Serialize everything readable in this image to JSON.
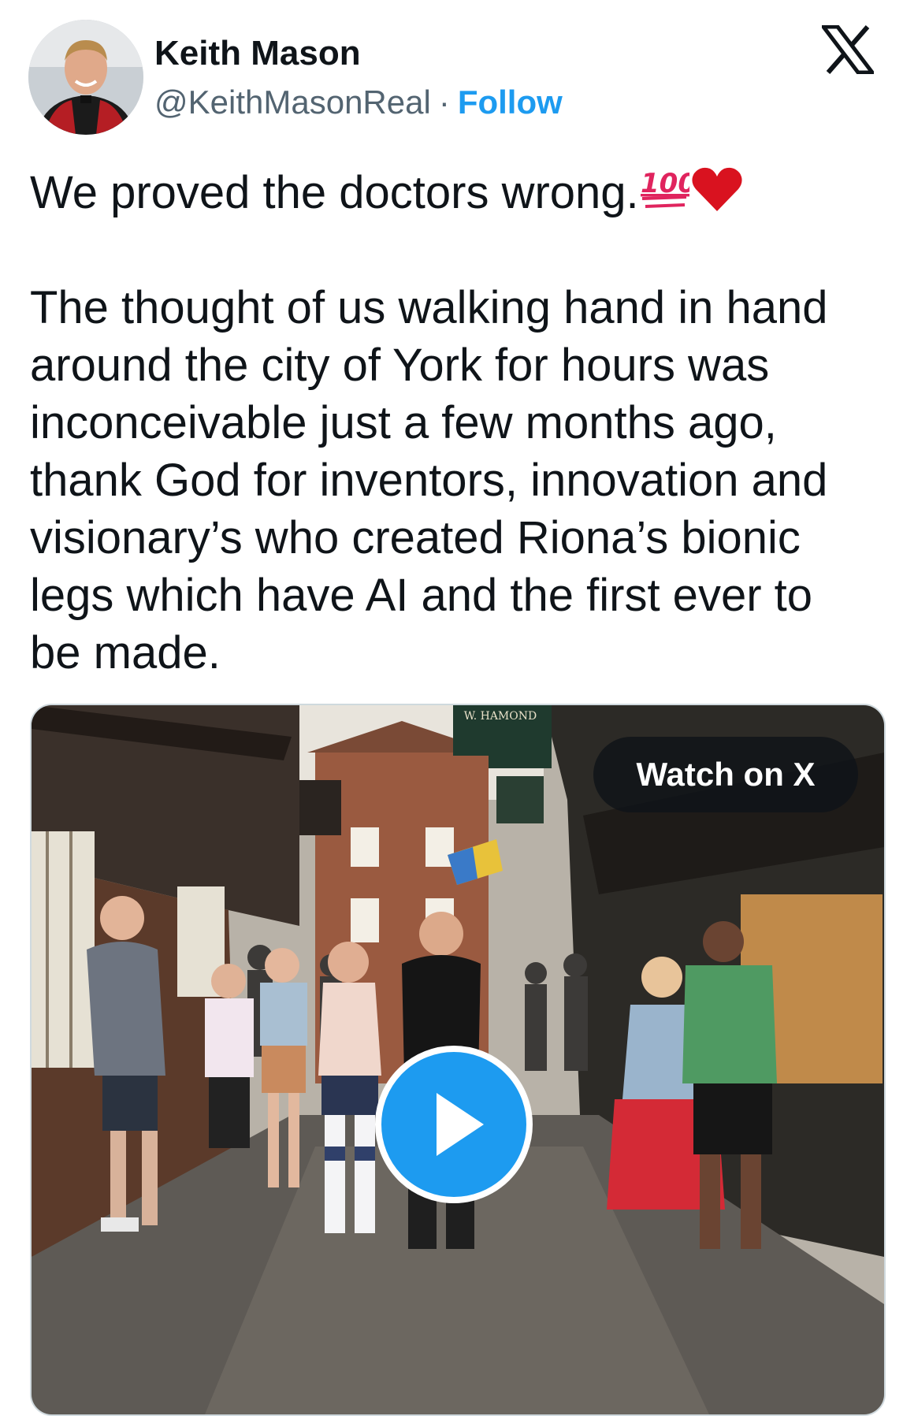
{
  "author": {
    "name": "Keith Mason",
    "handle": "@KeithMasonReal",
    "separator": "·",
    "follow_label": "Follow"
  },
  "brand": {
    "logo_icon": "x-logo-icon",
    "accent_color": "#1d9bf0"
  },
  "tweet": {
    "line1": "We proved the doctors wrong.",
    "emoji_1": "hundred-points-icon",
    "emoji_2": "red-heart-icon",
    "body_lines": [
      "The thought of us walking hand in hand",
      "around the city of York for hours was",
      "inconceivable just a few months ago,",
      "thank God for inventors, innovation and",
      "visionary’s who created Riona’s bionic",
      "legs which have AI and the first ever to",
      "be made."
    ]
  },
  "media": {
    "watch_label": "Watch on X",
    "play_icon": "play-icon",
    "sign_text": "W. HAMOND"
  }
}
